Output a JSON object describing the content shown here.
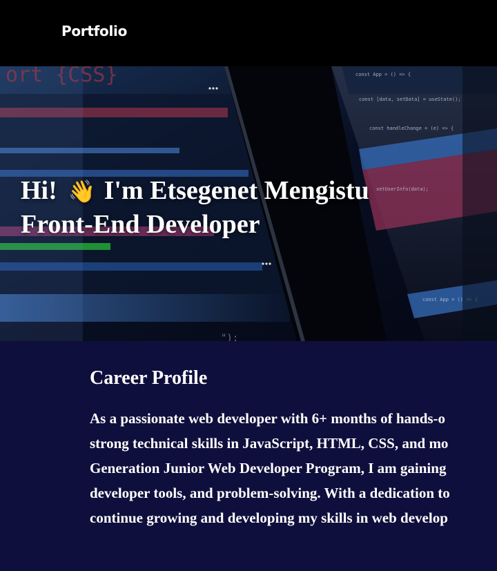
{
  "nav": {
    "brand": "Portfolio"
  },
  "hero": {
    "greeting": "Hi!",
    "wave_emoji": "👋",
    "name_line": "I'm Etsegenet Mengistu",
    "role_line": "Front-End Developer",
    "background": "code-screens-image",
    "code_snippets": [
      "const App = () => {",
      "const [data, setData] = useState();",
      "const handleChange = (e) => {",
      "setUserInfo(data);",
      "const App = () => {"
    ]
  },
  "profile": {
    "title": "Career Profile",
    "lines": [
      "As a passionate web developer with 6+ months of hands-o",
      "strong technical skills in JavaScript, HTML, CSS, and mo",
      "Generation Junior Web Developer Program, I am gaining",
      "developer tools, and problem-solving. With a dedication to",
      "continue growing and developing my skills in web develop"
    ]
  },
  "colors": {
    "nav_bg": "#000000",
    "profile_bg": "#0f0f3d",
    "text": "#ffffff"
  }
}
